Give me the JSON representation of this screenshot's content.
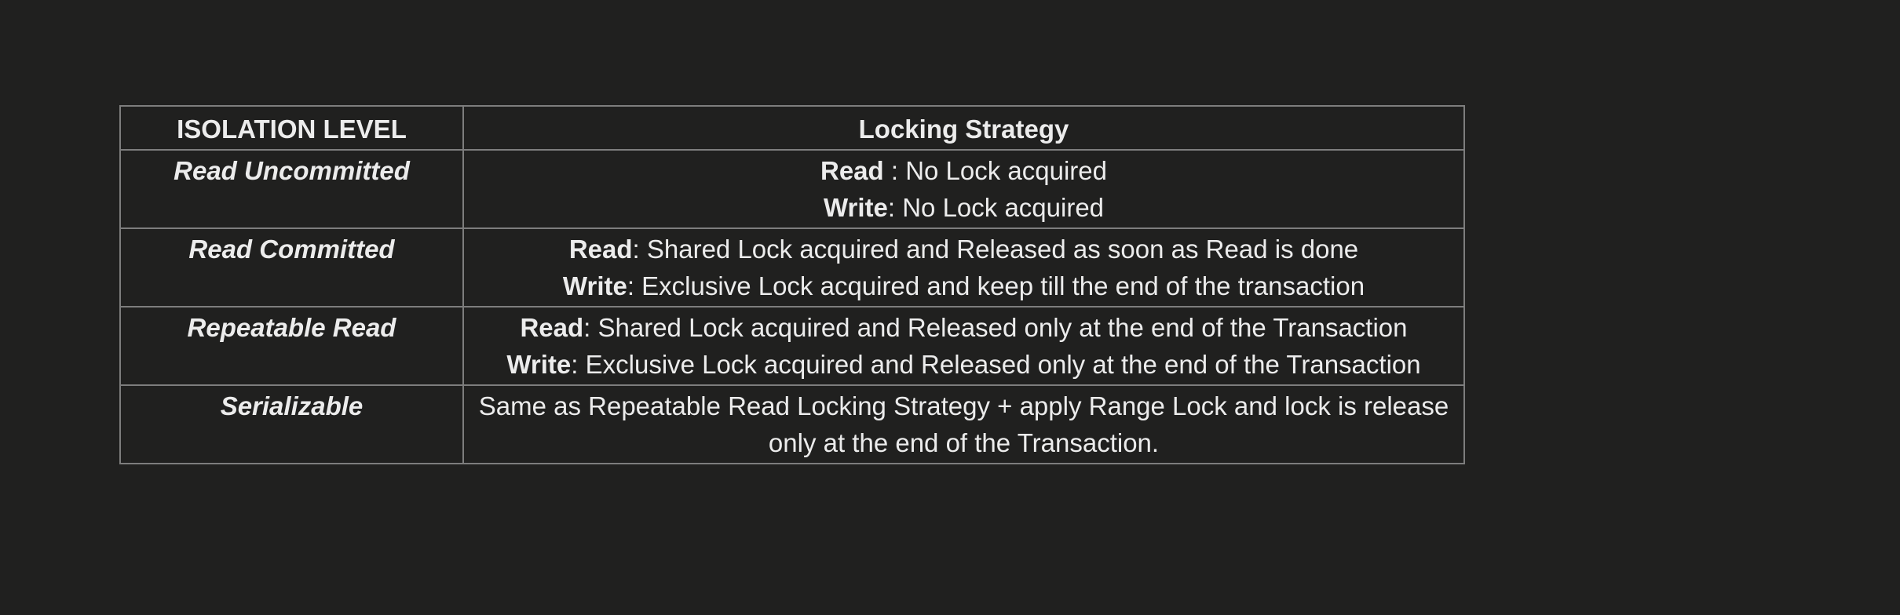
{
  "table": {
    "headers": {
      "level": "ISOLATION LEVEL",
      "strategy": "Locking Strategy"
    },
    "rows": [
      {
        "level": "Read Uncommitted",
        "lines": [
          {
            "keyword": "Read",
            "text": " : No Lock acquired"
          },
          {
            "keyword": "Write",
            "text": ": No Lock acquired"
          }
        ]
      },
      {
        "level": "Read Committed",
        "lines": [
          {
            "keyword": "Read",
            "text": ": Shared Lock acquired and Released as soon as Read is done"
          },
          {
            "keyword": "Write",
            "text": ": Exclusive Lock acquired and keep till the end of the transaction"
          }
        ]
      },
      {
        "level": "Repeatable Read",
        "lines": [
          {
            "keyword": "Read",
            "text": ": Shared Lock acquired and Released only at the end of the Transaction"
          },
          {
            "keyword": "Write",
            "text": ": Exclusive Lock acquired and Released only at the end of the Transaction"
          }
        ]
      },
      {
        "level": "Serializable",
        "lines": [
          {
            "keyword": "",
            "text": "Same as Repeatable Read Locking Strategy + apply Range Lock and lock is release"
          },
          {
            "keyword": "",
            "text": "only at the end of the Transaction."
          }
        ]
      }
    ]
  }
}
